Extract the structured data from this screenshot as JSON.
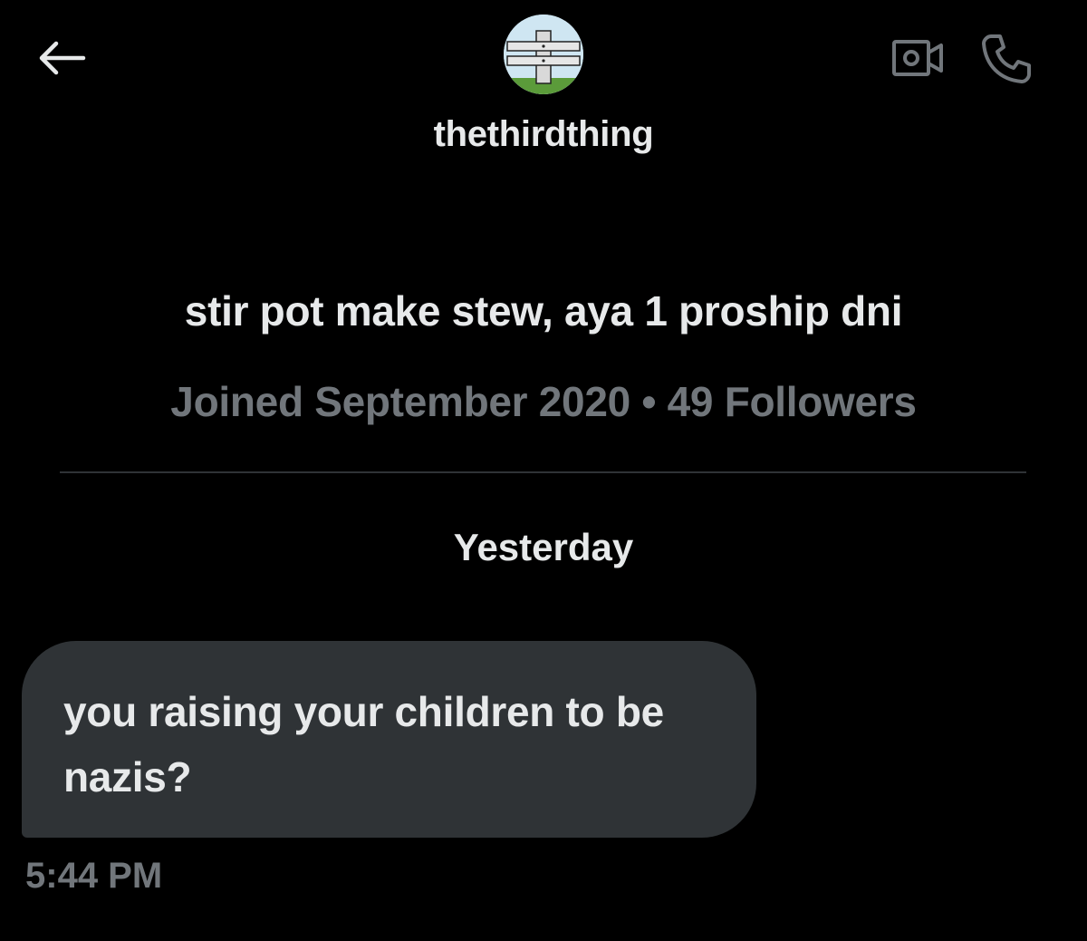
{
  "header": {
    "back_icon": "arrow-left-icon",
    "video_icon": "video-camera-icon",
    "call_icon": "phone-icon",
    "avatar_icon": "profile-avatar"
  },
  "profile": {
    "username": "thethirdthing",
    "bio": "stir pot make stew, aya 1 proship dni",
    "meta": "Joined September 2020 • 49 Followers"
  },
  "conversation": {
    "date_separator": "Yesterday",
    "messages": [
      {
        "text": "you raising your children to be nazis?",
        "time": "5:44 PM"
      }
    ]
  },
  "colors": {
    "background": "#000000",
    "primary_text": "#e7e9ea",
    "secondary_text": "#71767b",
    "bubble": "#2f3336",
    "divider": "#2f3336"
  }
}
